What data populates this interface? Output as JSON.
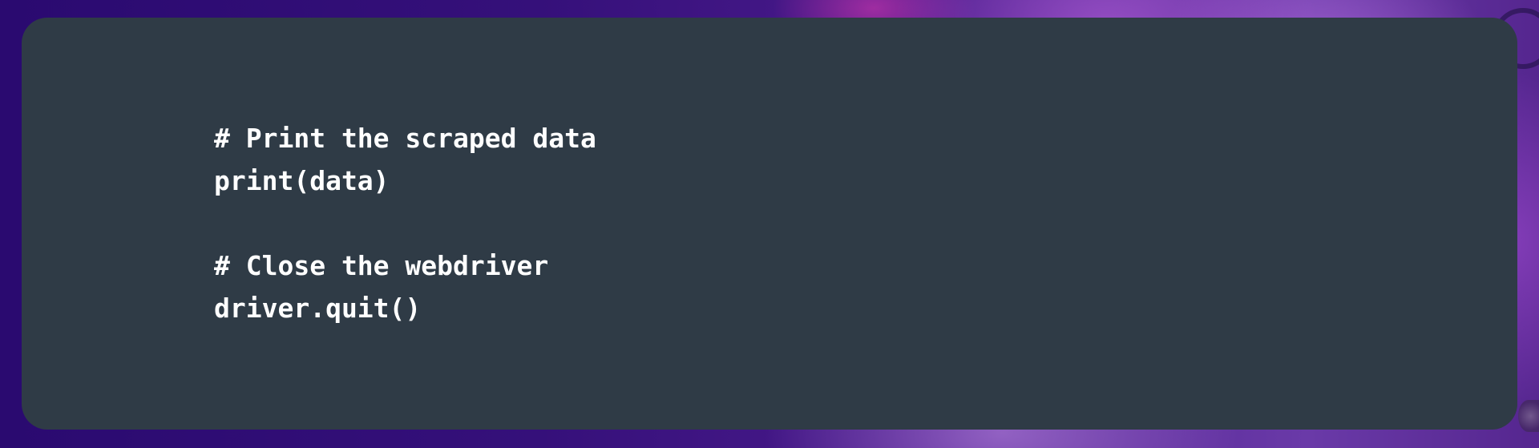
{
  "code": {
    "lines": [
      "# Print the scraped data",
      "print(data)",
      "",
      "# Close the webdriver",
      "driver.quit()"
    ]
  },
  "colors": {
    "card_background": "#2f3b46",
    "code_text": "#ffffff",
    "page_background": "#35107a"
  }
}
